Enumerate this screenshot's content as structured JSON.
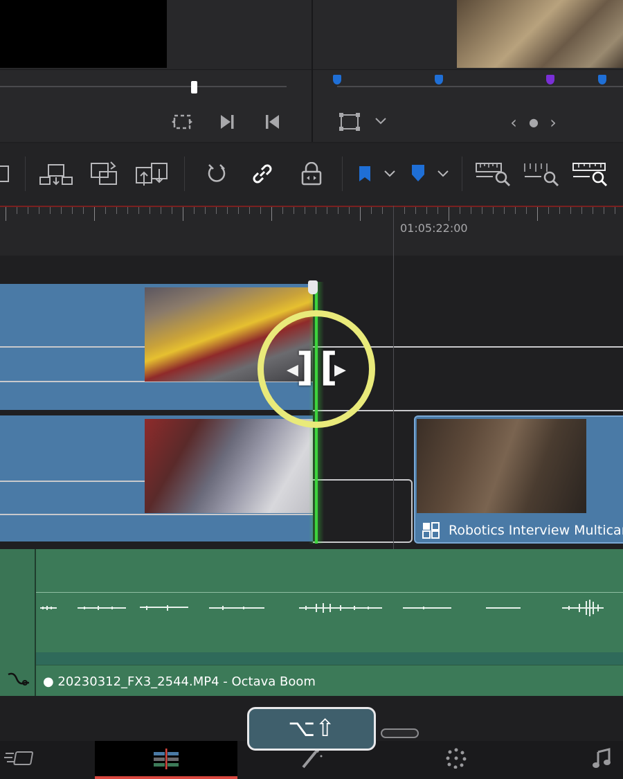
{
  "viewer": {
    "controls_left": {
      "loop_icon": "loop-icon",
      "next_clip_icon": "next-clip-icon",
      "prev_clip_icon": "prev-clip-icon"
    },
    "controls_right": {
      "transform_icon": "transform-icon",
      "chevron": "chevron-down-icon",
      "nav_prev": "‹",
      "nav_dot": "●",
      "nav_next": "›"
    },
    "markers": [
      {
        "color": "#1f6fd6"
      },
      {
        "color": "#1f6fd6"
      },
      {
        "color": "#7a2fd6"
      },
      {
        "color": "#1f6fd6"
      }
    ]
  },
  "toolbar": {
    "items": [
      "append-icon",
      "overwrite-icon",
      "replace-icon",
      "swap-icon",
      "snapping-icon",
      "link-icon",
      "lock-icon",
      "flag-icon",
      "marker-icon",
      "zoom-full-icon",
      "zoom-detail-icon",
      "zoom-custom-icon"
    ],
    "flag_color": "#1f6fd6",
    "marker_color": "#1f6fd6"
  },
  "ruler": {
    "timecode": "01:05:22:00"
  },
  "timeline": {
    "multicam_clip_label": "Robotics Interview Multicam",
    "audio_clip_label": "● 20230312_FX3_2544.MP4 - Octava Boom",
    "trim_left": "]",
    "trim_right": "[",
    "trim_left_arrow": "◀",
    "trim_right_arrow": "▶"
  },
  "shortcut": {
    "keys": "⌥⇧"
  },
  "tabs": [
    {
      "name": "cut-page-icon",
      "active": false
    },
    {
      "name": "edit-page-icon",
      "active": true
    },
    {
      "name": "fusion-page-icon",
      "active": false
    },
    {
      "name": "color-page-icon",
      "active": false
    },
    {
      "name": "fairlight-page-icon",
      "active": false
    }
  ],
  "colors": {
    "accent_red": "#d9473f",
    "playhead_green": "#3dd43d",
    "highlight_yellow": "#e9ea7a",
    "clip_blue": "#4a7aa6",
    "audio_green": "#3c7a58"
  }
}
